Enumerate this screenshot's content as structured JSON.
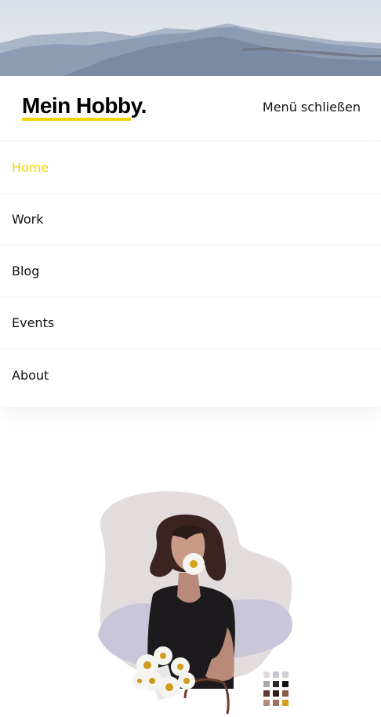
{
  "header": {
    "logo_text": "Mein Hobby.",
    "menu_toggle_label": "Menü schließen"
  },
  "nav": {
    "items": [
      {
        "label": "Home",
        "active": true
      },
      {
        "label": "Work",
        "active": false
      },
      {
        "label": "Blog",
        "active": false
      },
      {
        "label": "Events",
        "active": false
      },
      {
        "label": "About",
        "active": false
      }
    ]
  },
  "colors": {
    "accent": "#f3d400",
    "active_nav": "#f1d800",
    "text": "#111111"
  },
  "palette": {
    "swatches": [
      "#e2d9db",
      "#c9c6d8",
      "#cfcfd1",
      "#a9a9a9",
      "#2e2a2a",
      "#111111",
      "#5e3b30",
      "#2c1e1a",
      "#8a5a44",
      "#b38b7b",
      "#9e6f5c",
      "#d69d1c"
    ]
  }
}
